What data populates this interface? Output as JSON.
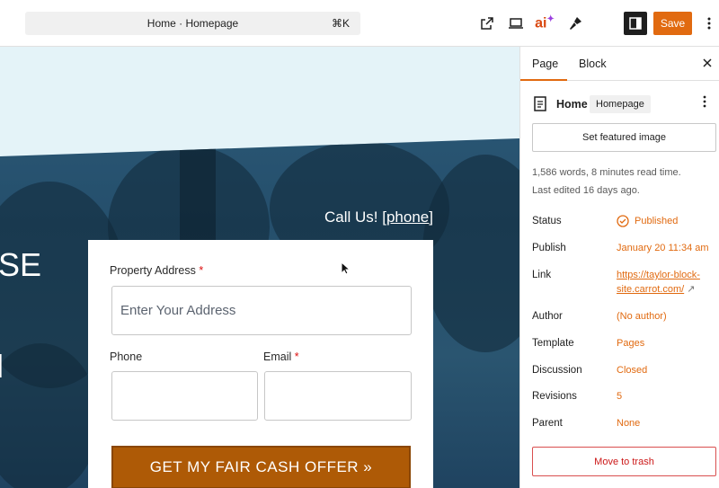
{
  "toolbar": {
    "command_title": "Home · Homepage",
    "command_shortcut": "⌘K",
    "ai_label": "ai",
    "save_label": "Save",
    "colors": {
      "accent": "#e16a10",
      "dark": "#1e1e1e"
    }
  },
  "canvas": {
    "cut_text_1": "SE",
    "cut_text_2": "l",
    "call_us_prefix": "Call Us! ",
    "call_us_phone": "[phone]",
    "form": {
      "address_label": "Property Address",
      "address_required": "*",
      "address_placeholder": "Enter Your Address",
      "phone_label": "Phone",
      "email_label": "Email",
      "email_required": "*",
      "submit_label": "GET MY FAIR CASH OFFER »"
    }
  },
  "sidebar": {
    "tabs": [
      {
        "label": "Page"
      },
      {
        "label": "Block"
      }
    ],
    "document": {
      "title": "Home",
      "badge": "Homepage"
    },
    "featured_image_button": "Set featured image",
    "word_count": "1,586 words, 8 minutes read time.",
    "last_edited": "Last edited 16 days ago.",
    "properties": {
      "status": {
        "label": "Status",
        "value": "Published"
      },
      "publish": {
        "label": "Publish",
        "value": "January 20 11:34 am"
      },
      "link": {
        "label": "Link",
        "value_line1": "https://taylor-block-",
        "value_line2": "site.carrot.com/",
        "arrow": "↗"
      },
      "author": {
        "label": "Author",
        "value": "(No author)"
      },
      "template": {
        "label": "Template",
        "value": "Pages"
      },
      "discussion": {
        "label": "Discussion",
        "value": "Closed"
      },
      "revisions": {
        "label": "Revisions",
        "value": "5"
      },
      "parent": {
        "label": "Parent",
        "value": "None"
      }
    },
    "trash_button": "Move to trash"
  }
}
